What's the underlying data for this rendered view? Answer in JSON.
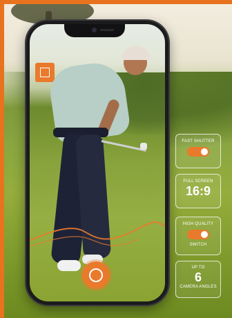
{
  "colors": {
    "accent": "#e97a2c",
    "frame": "#1b1b1d"
  },
  "features": [
    {
      "label": "FAST SHUTTER",
      "control": "toggle",
      "state": "on"
    },
    {
      "label": "FULL SCREEN",
      "value": "16:9"
    },
    {
      "label": "HIGH QUALITY",
      "control": "toggle",
      "state": "on",
      "sublabel": "SWITCH"
    },
    {
      "label": "UP TO",
      "value": "6",
      "sublabel": "CAMERA ANGLES"
    }
  ],
  "icons": {
    "frame": "crop-frame-icon",
    "shutter": "shutter-button-icon"
  }
}
